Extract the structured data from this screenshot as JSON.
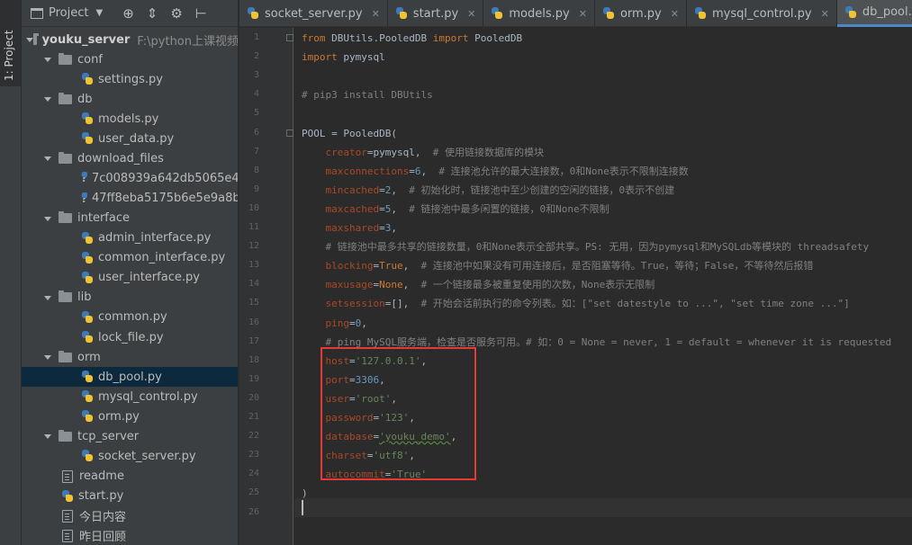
{
  "left_strip": {
    "label": "1: Project"
  },
  "project_panel": {
    "title": "Project",
    "tree": [
      {
        "label": "youku_server",
        "detail": "F:\\python上课视频",
        "type": "root",
        "indent": 0,
        "expanded": true
      },
      {
        "label": "conf",
        "type": "folder",
        "indent": 1,
        "expanded": true
      },
      {
        "label": "settings.py",
        "type": "py",
        "indent": 2
      },
      {
        "label": "db",
        "type": "folder",
        "indent": 1,
        "expanded": true
      },
      {
        "label": "models.py",
        "type": "py",
        "indent": 2
      },
      {
        "label": "user_data.py",
        "type": "py",
        "indent": 2
      },
      {
        "label": "download_files",
        "type": "folder",
        "indent": 1,
        "expanded": true
      },
      {
        "label": "7c008939a642db5065e4",
        "type": "unknown",
        "indent": 2
      },
      {
        "label": "47ff8eba5175b6e5e9a8b",
        "type": "unknown",
        "indent": 2
      },
      {
        "label": "interface",
        "type": "folder",
        "indent": 1,
        "expanded": true
      },
      {
        "label": "admin_interface.py",
        "type": "py",
        "indent": 2
      },
      {
        "label": "common_interface.py",
        "type": "py",
        "indent": 2
      },
      {
        "label": "user_interface.py",
        "type": "py",
        "indent": 2
      },
      {
        "label": "lib",
        "type": "folder",
        "indent": 1,
        "expanded": true
      },
      {
        "label": "common.py",
        "type": "py",
        "indent": 2
      },
      {
        "label": "lock_file.py",
        "type": "py",
        "indent": 2
      },
      {
        "label": "orm",
        "type": "folder",
        "indent": 1,
        "expanded": true
      },
      {
        "label": "db_pool.py",
        "type": "py",
        "indent": 2,
        "selected": true
      },
      {
        "label": "mysql_control.py",
        "type": "py",
        "indent": 2
      },
      {
        "label": "orm.py",
        "type": "py",
        "indent": 2
      },
      {
        "label": "tcp_server",
        "type": "folder",
        "indent": 1,
        "expanded": true
      },
      {
        "label": "socket_server.py",
        "type": "py",
        "indent": 2
      },
      {
        "label": "readme",
        "type": "text",
        "indent": 1
      },
      {
        "label": "start.py",
        "type": "py",
        "indent": 1
      },
      {
        "label": "今日内容",
        "type": "text",
        "indent": 1
      },
      {
        "label": "昨日回顾",
        "type": "text",
        "indent": 1
      }
    ]
  },
  "tabs": [
    {
      "label": "socket_server.py",
      "active": false
    },
    {
      "label": "start.py",
      "active": false
    },
    {
      "label": "models.py",
      "active": false
    },
    {
      "label": "orm.py",
      "active": false
    },
    {
      "label": "mysql_control.py",
      "active": false
    },
    {
      "label": "db_pool.py",
      "active": true
    }
  ],
  "editor": {
    "lines": [
      [
        [
          "kw",
          "from"
        ],
        [
          "n",
          " DBUtils.PooledDB "
        ],
        [
          "kw",
          "import"
        ],
        [
          "n",
          " PooledDB"
        ]
      ],
      [
        [
          "kw",
          "import"
        ],
        [
          "n",
          " pymysql"
        ]
      ],
      [],
      [
        [
          "cm",
          "# pip3 install DBUtils"
        ]
      ],
      [],
      [
        [
          "n",
          "POOL = PooledDB("
        ]
      ],
      [
        [
          "n",
          "    "
        ],
        [
          "param",
          "creator"
        ],
        [
          "n",
          "=pymysql,  "
        ],
        [
          "cm",
          "# 使用链接数据库的模块"
        ]
      ],
      [
        [
          "n",
          "    "
        ],
        [
          "param",
          "maxconnections"
        ],
        [
          "n",
          "="
        ],
        [
          "num",
          "6"
        ],
        [
          "n",
          ",  "
        ],
        [
          "cm",
          "# 连接池允许的最大连接数，0和None表示不限制连接数"
        ]
      ],
      [
        [
          "n",
          "    "
        ],
        [
          "param",
          "mincached"
        ],
        [
          "n",
          "="
        ],
        [
          "num",
          "2"
        ],
        [
          "n",
          ",  "
        ],
        [
          "cm",
          "# 初始化时，链接池中至少创建的空闲的链接，0表示不创建"
        ]
      ],
      [
        [
          "n",
          "    "
        ],
        [
          "param",
          "maxcached"
        ],
        [
          "n",
          "="
        ],
        [
          "num",
          "5"
        ],
        [
          "n",
          ",  "
        ],
        [
          "cm",
          "# 链接池中最多闲置的链接，0和None不限制"
        ]
      ],
      [
        [
          "n",
          "    "
        ],
        [
          "param",
          "maxshared"
        ],
        [
          "n",
          "="
        ],
        [
          "num",
          "3"
        ],
        [
          "n",
          ","
        ]
      ],
      [
        [
          "n",
          "    "
        ],
        [
          "cm",
          "# 链接池中最多共享的链接数量，0和None表示全部共享。PS: 无用，因为pymysql和MySQLdb等模块的 threadsafety"
        ]
      ],
      [
        [
          "n",
          "    "
        ],
        [
          "param",
          "blocking"
        ],
        [
          "n",
          "="
        ],
        [
          "kw",
          "True"
        ],
        [
          "n",
          ",  "
        ],
        [
          "cm",
          "# 连接池中如果没有可用连接后，是否阻塞等待。True，等待；False，不等待然后报错"
        ]
      ],
      [
        [
          "n",
          "    "
        ],
        [
          "param",
          "maxusage"
        ],
        [
          "n",
          "="
        ],
        [
          "kw",
          "None"
        ],
        [
          "n",
          ",  "
        ],
        [
          "cm",
          "# 一个链接最多被重复使用的次数，None表示无限制"
        ]
      ],
      [
        [
          "n",
          "    "
        ],
        [
          "param",
          "setsession"
        ],
        [
          "n",
          "=[],  "
        ],
        [
          "cm",
          "# 开始会话前执行的命令列表。如：[\"set datestyle to ...\", \"set time zone ...\"]"
        ]
      ],
      [
        [
          "n",
          "    "
        ],
        [
          "param",
          "ping"
        ],
        [
          "n",
          "="
        ],
        [
          "num",
          "0"
        ],
        [
          "n",
          ","
        ]
      ],
      [
        [
          "n",
          "    "
        ],
        [
          "cm",
          "# ping MySQL服务端，检查是否服务可用。# 如：0 = None = never, 1 = default = whenever it is requested"
        ]
      ],
      [
        [
          "n",
          "    "
        ],
        [
          "param",
          "host"
        ],
        [
          "n",
          "="
        ],
        [
          "str",
          "'127.0.0.1'"
        ],
        [
          "n",
          ","
        ]
      ],
      [
        [
          "n",
          "    "
        ],
        [
          "param",
          "port"
        ],
        [
          "n",
          "="
        ],
        [
          "num",
          "3306"
        ],
        [
          "n",
          ","
        ]
      ],
      [
        [
          "n",
          "    "
        ],
        [
          "param",
          "user"
        ],
        [
          "n",
          "="
        ],
        [
          "str",
          "'root'"
        ],
        [
          "n",
          ","
        ]
      ],
      [
        [
          "n",
          "    "
        ],
        [
          "param",
          "password"
        ],
        [
          "n",
          "="
        ],
        [
          "str",
          "'123'"
        ],
        [
          "n",
          ","
        ]
      ],
      [
        [
          "n",
          "    "
        ],
        [
          "param",
          "database"
        ],
        [
          "n",
          "="
        ],
        [
          "str",
          "'youku_demo'"
        ],
        [
          "n",
          ","
        ]
      ],
      [
        [
          "n",
          "    "
        ],
        [
          "param",
          "charset"
        ],
        [
          "n",
          "="
        ],
        [
          "str",
          "'utf8'"
        ],
        [
          "n",
          ","
        ]
      ],
      [
        [
          "n",
          "    "
        ],
        [
          "param",
          "autocommit"
        ],
        [
          "n",
          "="
        ],
        [
          "str",
          "'True'"
        ]
      ],
      [
        [
          "n",
          ")"
        ]
      ],
      []
    ]
  },
  "colors": {
    "keyword": "#cc7832",
    "param": "#aa4926",
    "comment": "#808080",
    "string": "#6a8759",
    "number": "#6897bb",
    "text": "#a9b7c6",
    "highlight_box": "#e53935",
    "active_tab_underline": "#4a88c7"
  }
}
